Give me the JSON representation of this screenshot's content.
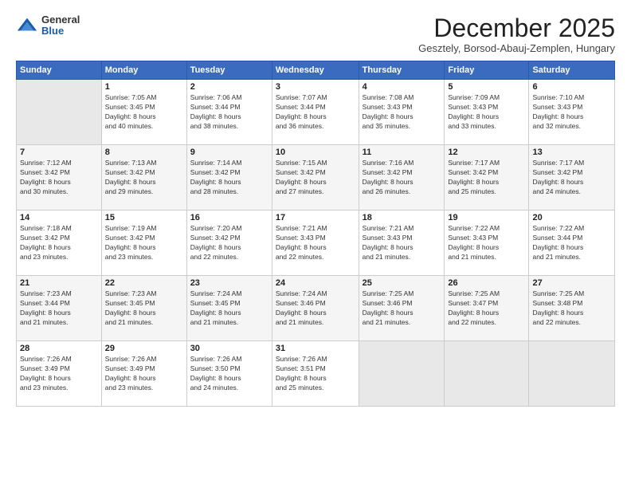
{
  "logo": {
    "general": "General",
    "blue": "Blue"
  },
  "header": {
    "month": "December 2025",
    "location": "Gesztely, Borsod-Abauj-Zemplen, Hungary"
  },
  "days_of_week": [
    "Sunday",
    "Monday",
    "Tuesday",
    "Wednesday",
    "Thursday",
    "Friday",
    "Saturday"
  ],
  "weeks": [
    [
      {
        "day": "",
        "sunrise": "",
        "sunset": "",
        "daylight": ""
      },
      {
        "day": "1",
        "sunrise": "Sunrise: 7:05 AM",
        "sunset": "Sunset: 3:45 PM",
        "daylight": "Daylight: 8 hours and 40 minutes."
      },
      {
        "day": "2",
        "sunrise": "Sunrise: 7:06 AM",
        "sunset": "Sunset: 3:44 PM",
        "daylight": "Daylight: 8 hours and 38 minutes."
      },
      {
        "day": "3",
        "sunrise": "Sunrise: 7:07 AM",
        "sunset": "Sunset: 3:44 PM",
        "daylight": "Daylight: 8 hours and 36 minutes."
      },
      {
        "day": "4",
        "sunrise": "Sunrise: 7:08 AM",
        "sunset": "Sunset: 3:43 PM",
        "daylight": "Daylight: 8 hours and 35 minutes."
      },
      {
        "day": "5",
        "sunrise": "Sunrise: 7:09 AM",
        "sunset": "Sunset: 3:43 PM",
        "daylight": "Daylight: 8 hours and 33 minutes."
      },
      {
        "day": "6",
        "sunrise": "Sunrise: 7:10 AM",
        "sunset": "Sunset: 3:43 PM",
        "daylight": "Daylight: 8 hours and 32 minutes."
      }
    ],
    [
      {
        "day": "7",
        "sunrise": "Sunrise: 7:12 AM",
        "sunset": "Sunset: 3:42 PM",
        "daylight": "Daylight: 8 hours and 30 minutes."
      },
      {
        "day": "8",
        "sunrise": "Sunrise: 7:13 AM",
        "sunset": "Sunset: 3:42 PM",
        "daylight": "Daylight: 8 hours and 29 minutes."
      },
      {
        "day": "9",
        "sunrise": "Sunrise: 7:14 AM",
        "sunset": "Sunset: 3:42 PM",
        "daylight": "Daylight: 8 hours and 28 minutes."
      },
      {
        "day": "10",
        "sunrise": "Sunrise: 7:15 AM",
        "sunset": "Sunset: 3:42 PM",
        "daylight": "Daylight: 8 hours and 27 minutes."
      },
      {
        "day": "11",
        "sunrise": "Sunrise: 7:16 AM",
        "sunset": "Sunset: 3:42 PM",
        "daylight": "Daylight: 8 hours and 26 minutes."
      },
      {
        "day": "12",
        "sunrise": "Sunrise: 7:17 AM",
        "sunset": "Sunset: 3:42 PM",
        "daylight": "Daylight: 8 hours and 25 minutes."
      },
      {
        "day": "13",
        "sunrise": "Sunrise: 7:17 AM",
        "sunset": "Sunset: 3:42 PM",
        "daylight": "Daylight: 8 hours and 24 minutes."
      }
    ],
    [
      {
        "day": "14",
        "sunrise": "Sunrise: 7:18 AM",
        "sunset": "Sunset: 3:42 PM",
        "daylight": "Daylight: 8 hours and 23 minutes."
      },
      {
        "day": "15",
        "sunrise": "Sunrise: 7:19 AM",
        "sunset": "Sunset: 3:42 PM",
        "daylight": "Daylight: 8 hours and 23 minutes."
      },
      {
        "day": "16",
        "sunrise": "Sunrise: 7:20 AM",
        "sunset": "Sunset: 3:42 PM",
        "daylight": "Daylight: 8 hours and 22 minutes."
      },
      {
        "day": "17",
        "sunrise": "Sunrise: 7:21 AM",
        "sunset": "Sunset: 3:43 PM",
        "daylight": "Daylight: 8 hours and 22 minutes."
      },
      {
        "day": "18",
        "sunrise": "Sunrise: 7:21 AM",
        "sunset": "Sunset: 3:43 PM",
        "daylight": "Daylight: 8 hours and 21 minutes."
      },
      {
        "day": "19",
        "sunrise": "Sunrise: 7:22 AM",
        "sunset": "Sunset: 3:43 PM",
        "daylight": "Daylight: 8 hours and 21 minutes."
      },
      {
        "day": "20",
        "sunrise": "Sunrise: 7:22 AM",
        "sunset": "Sunset: 3:44 PM",
        "daylight": "Daylight: 8 hours and 21 minutes."
      }
    ],
    [
      {
        "day": "21",
        "sunrise": "Sunrise: 7:23 AM",
        "sunset": "Sunset: 3:44 PM",
        "daylight": "Daylight: 8 hours and 21 minutes."
      },
      {
        "day": "22",
        "sunrise": "Sunrise: 7:23 AM",
        "sunset": "Sunset: 3:45 PM",
        "daylight": "Daylight: 8 hours and 21 minutes."
      },
      {
        "day": "23",
        "sunrise": "Sunrise: 7:24 AM",
        "sunset": "Sunset: 3:45 PM",
        "daylight": "Daylight: 8 hours and 21 minutes."
      },
      {
        "day": "24",
        "sunrise": "Sunrise: 7:24 AM",
        "sunset": "Sunset: 3:46 PM",
        "daylight": "Daylight: 8 hours and 21 minutes."
      },
      {
        "day": "25",
        "sunrise": "Sunrise: 7:25 AM",
        "sunset": "Sunset: 3:46 PM",
        "daylight": "Daylight: 8 hours and 21 minutes."
      },
      {
        "day": "26",
        "sunrise": "Sunrise: 7:25 AM",
        "sunset": "Sunset: 3:47 PM",
        "daylight": "Daylight: 8 hours and 22 minutes."
      },
      {
        "day": "27",
        "sunrise": "Sunrise: 7:25 AM",
        "sunset": "Sunset: 3:48 PM",
        "daylight": "Daylight: 8 hours and 22 minutes."
      }
    ],
    [
      {
        "day": "28",
        "sunrise": "Sunrise: 7:26 AM",
        "sunset": "Sunset: 3:49 PM",
        "daylight": "Daylight: 8 hours and 23 minutes."
      },
      {
        "day": "29",
        "sunrise": "Sunrise: 7:26 AM",
        "sunset": "Sunset: 3:49 PM",
        "daylight": "Daylight: 8 hours and 23 minutes."
      },
      {
        "day": "30",
        "sunrise": "Sunrise: 7:26 AM",
        "sunset": "Sunset: 3:50 PM",
        "daylight": "Daylight: 8 hours and 24 minutes."
      },
      {
        "day": "31",
        "sunrise": "Sunrise: 7:26 AM",
        "sunset": "Sunset: 3:51 PM",
        "daylight": "Daylight: 8 hours and 25 minutes."
      },
      {
        "day": "",
        "sunrise": "",
        "sunset": "",
        "daylight": ""
      },
      {
        "day": "",
        "sunrise": "",
        "sunset": "",
        "daylight": ""
      },
      {
        "day": "",
        "sunrise": "",
        "sunset": "",
        "daylight": ""
      }
    ]
  ]
}
